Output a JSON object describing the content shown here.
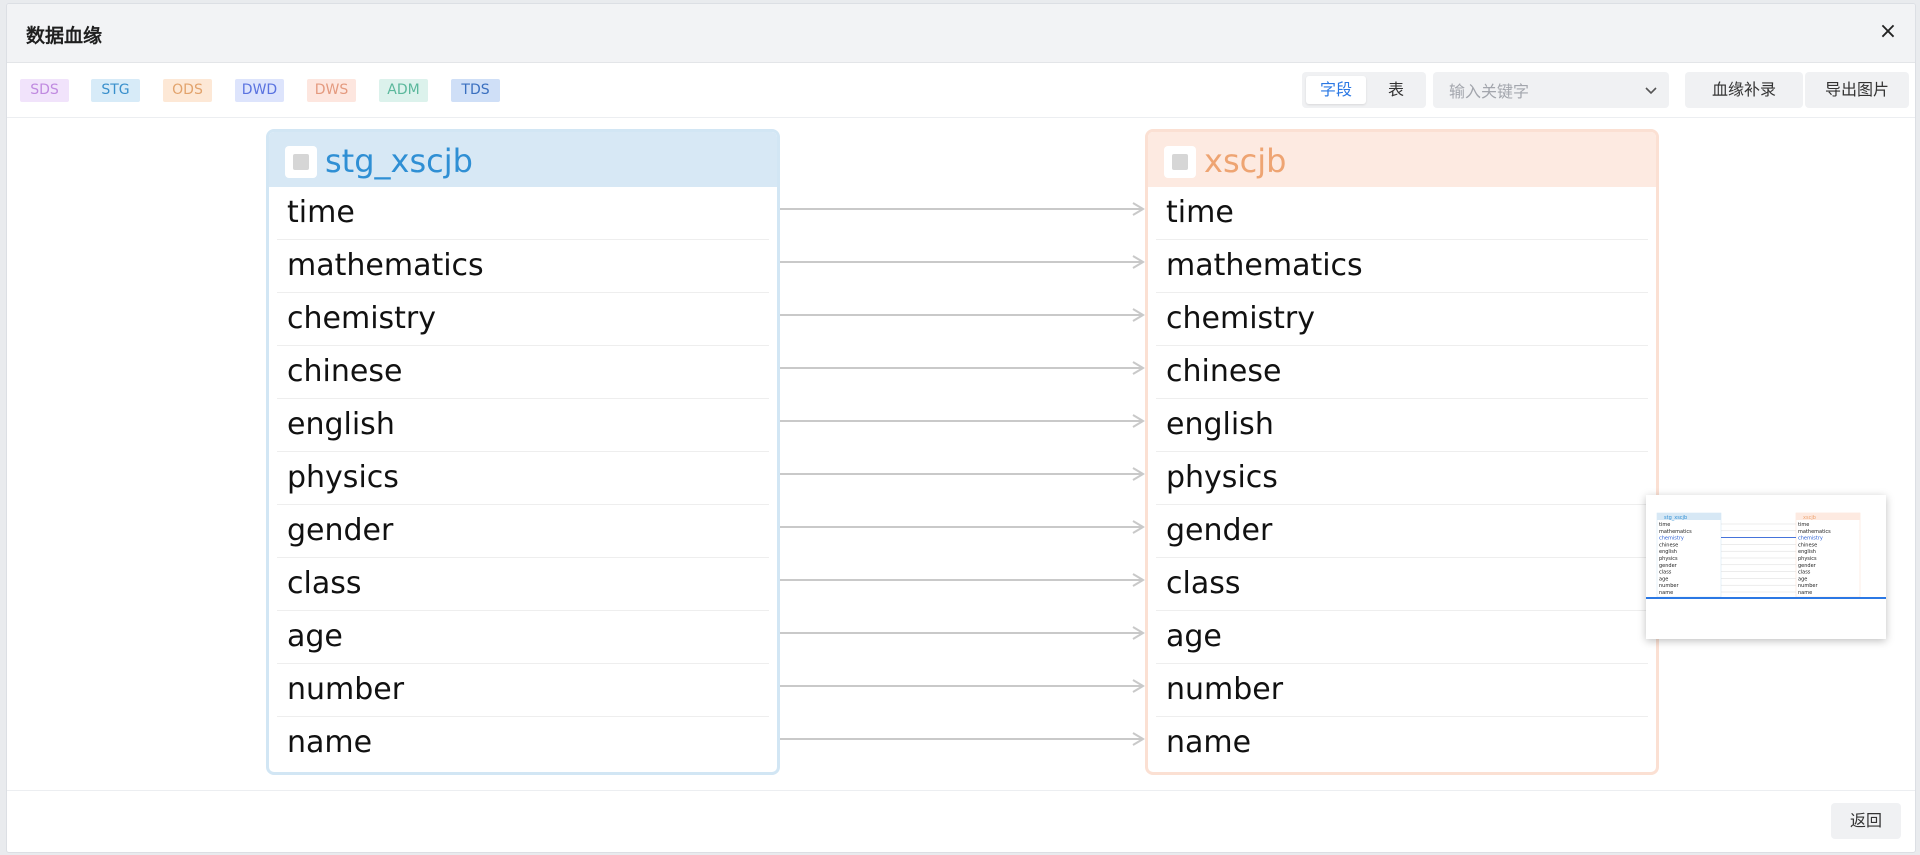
{
  "dialog": {
    "title": "数据血缘",
    "close_glyph": "×"
  },
  "layers": [
    {
      "label": "SDS",
      "bg": "#f1e3fb",
      "fg": "#c08ae0"
    },
    {
      "label": "STG",
      "bg": "#d7ebf8",
      "fg": "#3a90cc"
    },
    {
      "label": "ODS",
      "bg": "#fde8d6",
      "fg": "#e2a36c"
    },
    {
      "label": "DWD",
      "bg": "#dde4fc",
      "fg": "#5a73e0"
    },
    {
      "label": "DWS",
      "bg": "#fde6df",
      "fg": "#e49a7f"
    },
    {
      "label": "ADM",
      "bg": "#dcf2ec",
      "fg": "#5bb89c"
    },
    {
      "label": "TDS",
      "bg": "#cfdff7",
      "fg": "#3a6fbf"
    }
  ],
  "toolbar": {
    "mode_field": "字段",
    "mode_table": "表",
    "search_placeholder": "输入关键字",
    "lineage_supplement": "血缘补录",
    "export_image": "导出图片"
  },
  "source_table": {
    "name": "stg_xscjb",
    "color": "#2f8fd4",
    "header_bg": "#d7e8f5",
    "border": "#d2e6f4",
    "fields": [
      "time",
      "mathematics",
      "chemistry",
      "chinese",
      "english",
      "physics",
      "gender",
      "class",
      "age",
      "number",
      "name"
    ]
  },
  "target_table": {
    "name": "xscjb",
    "color": "#eea472",
    "header_bg": "#fdeae1",
    "border": "#fbe0d3",
    "fields": [
      "time",
      "mathematics",
      "chemistry",
      "chinese",
      "english",
      "physics",
      "gender",
      "class",
      "age",
      "number",
      "name"
    ]
  },
  "minimap": {
    "highlight_field": "chemistry"
  },
  "footer": {
    "back_label": "返回"
  }
}
